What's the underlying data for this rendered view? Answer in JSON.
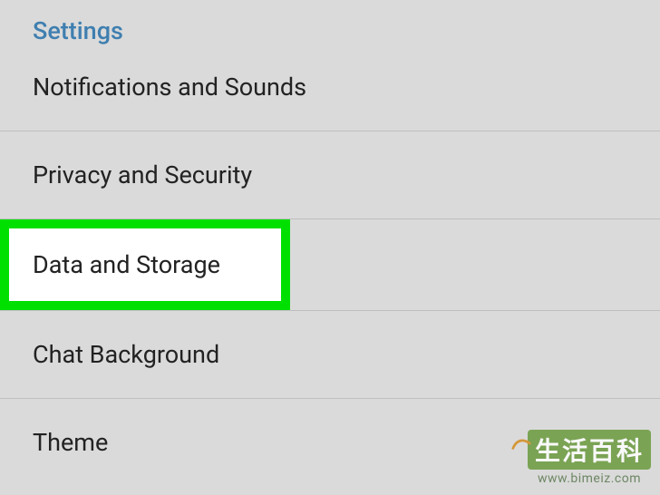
{
  "header": {
    "title": "Settings"
  },
  "items": [
    {
      "label": "Notifications and Sounds",
      "highlighted": false
    },
    {
      "label": "Privacy and Security",
      "highlighted": false
    },
    {
      "label": "Data and Storage",
      "highlighted": true
    },
    {
      "label": "Chat Background",
      "highlighted": false
    },
    {
      "label": "Theme",
      "highlighted": false
    }
  ],
  "watermark": {
    "chinese": "生活百科",
    "url": "www.bimeiz.com"
  }
}
